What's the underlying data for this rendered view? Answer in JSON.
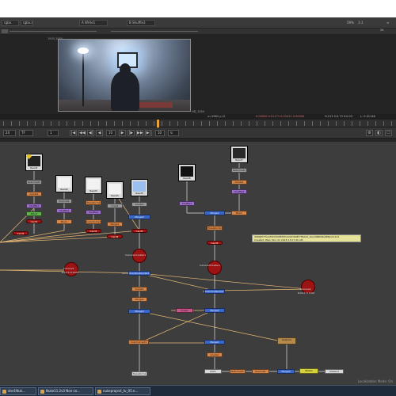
{
  "viewer": {
    "input_a": "A  Write1",
    "input_b": "B  Shuffle3",
    "zoom": "59%",
    "ratio": "1:1",
    "proxy_label": "2K",
    "frame_top_label": "1920,1080",
    "frame_bottom_label": "HD_1080",
    "info_coords": "x=1964 y=5",
    "info_rgba": "0.00000  0.01171  0.03411  0.00000",
    "info_hsv": "H:213 S:0.73 V:0.03",
    "info_l": "L: 0.01146"
  },
  "timeline": {
    "frame": "1",
    "fps": "24",
    "end_frame": "10"
  },
  "dag": {
    "reads": [
      {
        "label": "Read1",
        "thumb": "#222222",
        "accent": "#e0c020"
      },
      {
        "label": "Read2",
        "thumb": "#f2f2f2",
        "accent": "#c98d5a"
      },
      {
        "label": "Read3",
        "thumb": "#f2f2f2",
        "accent": "#c98d5a"
      },
      {
        "label": "Read4",
        "thumb": "#f2f2f2",
        "accent": "#c98d5a"
      },
      {
        "label": "Read5",
        "thumb": "#9ac0f0",
        "accent": "#9ac0f0"
      },
      {
        "label": "Read6",
        "thumb": "#111111",
        "accent": "#111111"
      },
      {
        "label": "Read7",
        "thumb": "#2a2a2a",
        "accent": "#777777"
      }
    ],
    "cameras": [
      {
        "label": "Camera1",
        "sub": "R1111111000"
      },
      {
        "label": "Camera1Cluster1",
        "sub": ""
      },
      {
        "label": "CameraCluster1",
        "sub": ""
      },
      {
        "label": "Camera3Cluster1",
        "sub": ""
      },
      {
        "label": "Camera4",
        "sub": "R1111111000"
      }
    ],
    "cards": [
      "Card1",
      "Card2",
      "Card3",
      "Card4",
      "Card5"
    ],
    "nodes": [
      "Write1",
      "Merge1",
      "Merge2",
      "Grade1",
      "Blur1",
      "ScanlineRender1",
      "Transform1",
      "Shuffle1",
      "Shuffle2",
      "Shuffle3",
      "Reformat1",
      "Premult1",
      "Roto1",
      "ColorCorrect1",
      "Dot1",
      "Crop1",
      "Viewer1",
      "Output1"
    ],
    "sticky_note": "/PROJECTS/x/PxDCDWESTCGCODSNET/TRACK_Dax/OBRVNs/BIN/s11121",
    "sticky_note_2": "Created: Wed, Nov 21 2018 13:07:40 AM",
    "footer_label": "Localization Mode: On"
  },
  "taskbar": {
    "items": [
      "dne1Nuk...",
      "Nuke11.2v3 Non-co...",
      "nukeproject_tv_05.n..."
    ]
  },
  "colors": {
    "dag_bg": "#3d3d3d",
    "wire": "#e6b774",
    "wire_white": "#e0e0e0",
    "node_orange": "#d8874a",
    "node_blue": "#3b68c8",
    "camera_red": "#9c1313",
    "playhead": "#e8a33a"
  }
}
